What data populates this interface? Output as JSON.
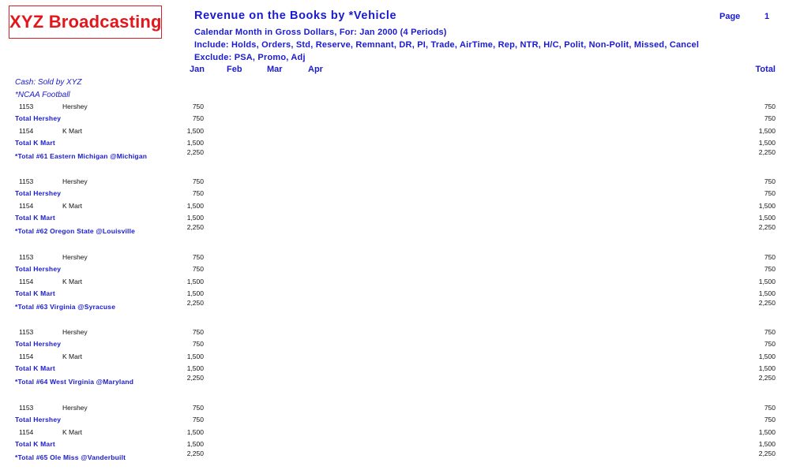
{
  "header": {
    "logo_text": "XYZ Broadcasting",
    "title": "Revenue on the Books by *Vehicle",
    "page_label": "Page",
    "page_number": "1",
    "subtitle_lines": [
      "Calendar Month in Gross Dollars, For:  Jan 2000 (4 Periods)",
      "Include: Holds, Orders, Std, Reserve, Remnant, DR, PI, Trade, AirTime, Rep, NTR, H/C, Polit, Non-Polit, Missed, Cancel",
      "Exclude: PSA, Promo, Adj"
    ]
  },
  "columns": {
    "months": [
      "Jan",
      "Feb",
      "Mar",
      "Apr"
    ],
    "total": "Total"
  },
  "sections": {
    "cash_label": "Cash: Sold by XYZ",
    "program_label": "*NCAA Football"
  },
  "groups": [
    {
      "rows": [
        {
          "type": "item",
          "account": "1153",
          "advertiser": "Hershey",
          "jan": "750",
          "total": "750"
        },
        {
          "type": "subtotal",
          "label": "Total Hershey",
          "jan": "750",
          "total": "750"
        },
        {
          "type": "item",
          "account": "1154",
          "advertiser": "K Mart",
          "jan": "1,500",
          "total": "1,500"
        },
        {
          "type": "subtotal",
          "label": "Total K Mart",
          "jan": "1,500",
          "total": "1,500"
        },
        {
          "type": "grand",
          "label": "*Total #61 Eastern Michigan @Michigan",
          "jan": "2,250",
          "total": "2,250"
        }
      ]
    },
    {
      "rows": [
        {
          "type": "item",
          "account": "1153",
          "advertiser": "Hershey",
          "jan": "750",
          "total": "750"
        },
        {
          "type": "subtotal",
          "label": "Total Hershey",
          "jan": "750",
          "total": "750"
        },
        {
          "type": "item",
          "account": "1154",
          "advertiser": "K Mart",
          "jan": "1,500",
          "total": "1,500"
        },
        {
          "type": "subtotal",
          "label": "Total K Mart",
          "jan": "1,500",
          "total": "1,500"
        },
        {
          "type": "grand",
          "label": "*Total #62 Oregon State @Louisville",
          "jan": "2,250",
          "total": "2,250"
        }
      ]
    },
    {
      "rows": [
        {
          "type": "item",
          "account": "1153",
          "advertiser": "Hershey",
          "jan": "750",
          "total": "750"
        },
        {
          "type": "subtotal",
          "label": "Total Hershey",
          "jan": "750",
          "total": "750"
        },
        {
          "type": "item",
          "account": "1154",
          "advertiser": "K Mart",
          "jan": "1,500",
          "total": "1,500"
        },
        {
          "type": "subtotal",
          "label": "Total K Mart",
          "jan": "1,500",
          "total": "1,500"
        },
        {
          "type": "grand",
          "label": "*Total #63 Virginia @Syracuse",
          "jan": "2,250",
          "total": "2,250"
        }
      ]
    },
    {
      "rows": [
        {
          "type": "item",
          "account": "1153",
          "advertiser": "Hershey",
          "jan": "750",
          "total": "750"
        },
        {
          "type": "subtotal",
          "label": "Total Hershey",
          "jan": "750",
          "total": "750"
        },
        {
          "type": "item",
          "account": "1154",
          "advertiser": "K Mart",
          "jan": "1,500",
          "total": "1,500"
        },
        {
          "type": "subtotal",
          "label": "Total K Mart",
          "jan": "1,500",
          "total": "1,500"
        },
        {
          "type": "grand",
          "label": "*Total #64 West Virginia @Maryland",
          "jan": "2,250",
          "total": "2,250"
        }
      ]
    },
    {
      "rows": [
        {
          "type": "item",
          "account": "1153",
          "advertiser": "Hershey",
          "jan": "750",
          "total": "750"
        },
        {
          "type": "subtotal",
          "label": "Total Hershey",
          "jan": "750",
          "total": "750"
        },
        {
          "type": "item",
          "account": "1154",
          "advertiser": "K Mart",
          "jan": "1,500",
          "total": "1,500"
        },
        {
          "type": "subtotal",
          "label": "Total K Mart",
          "jan": "1,500",
          "total": "1,500"
        },
        {
          "type": "grand",
          "label": "*Total #65 Ole Miss @Vanderbuilt",
          "jan": "2,250",
          "total": "2,250"
        }
      ]
    }
  ]
}
